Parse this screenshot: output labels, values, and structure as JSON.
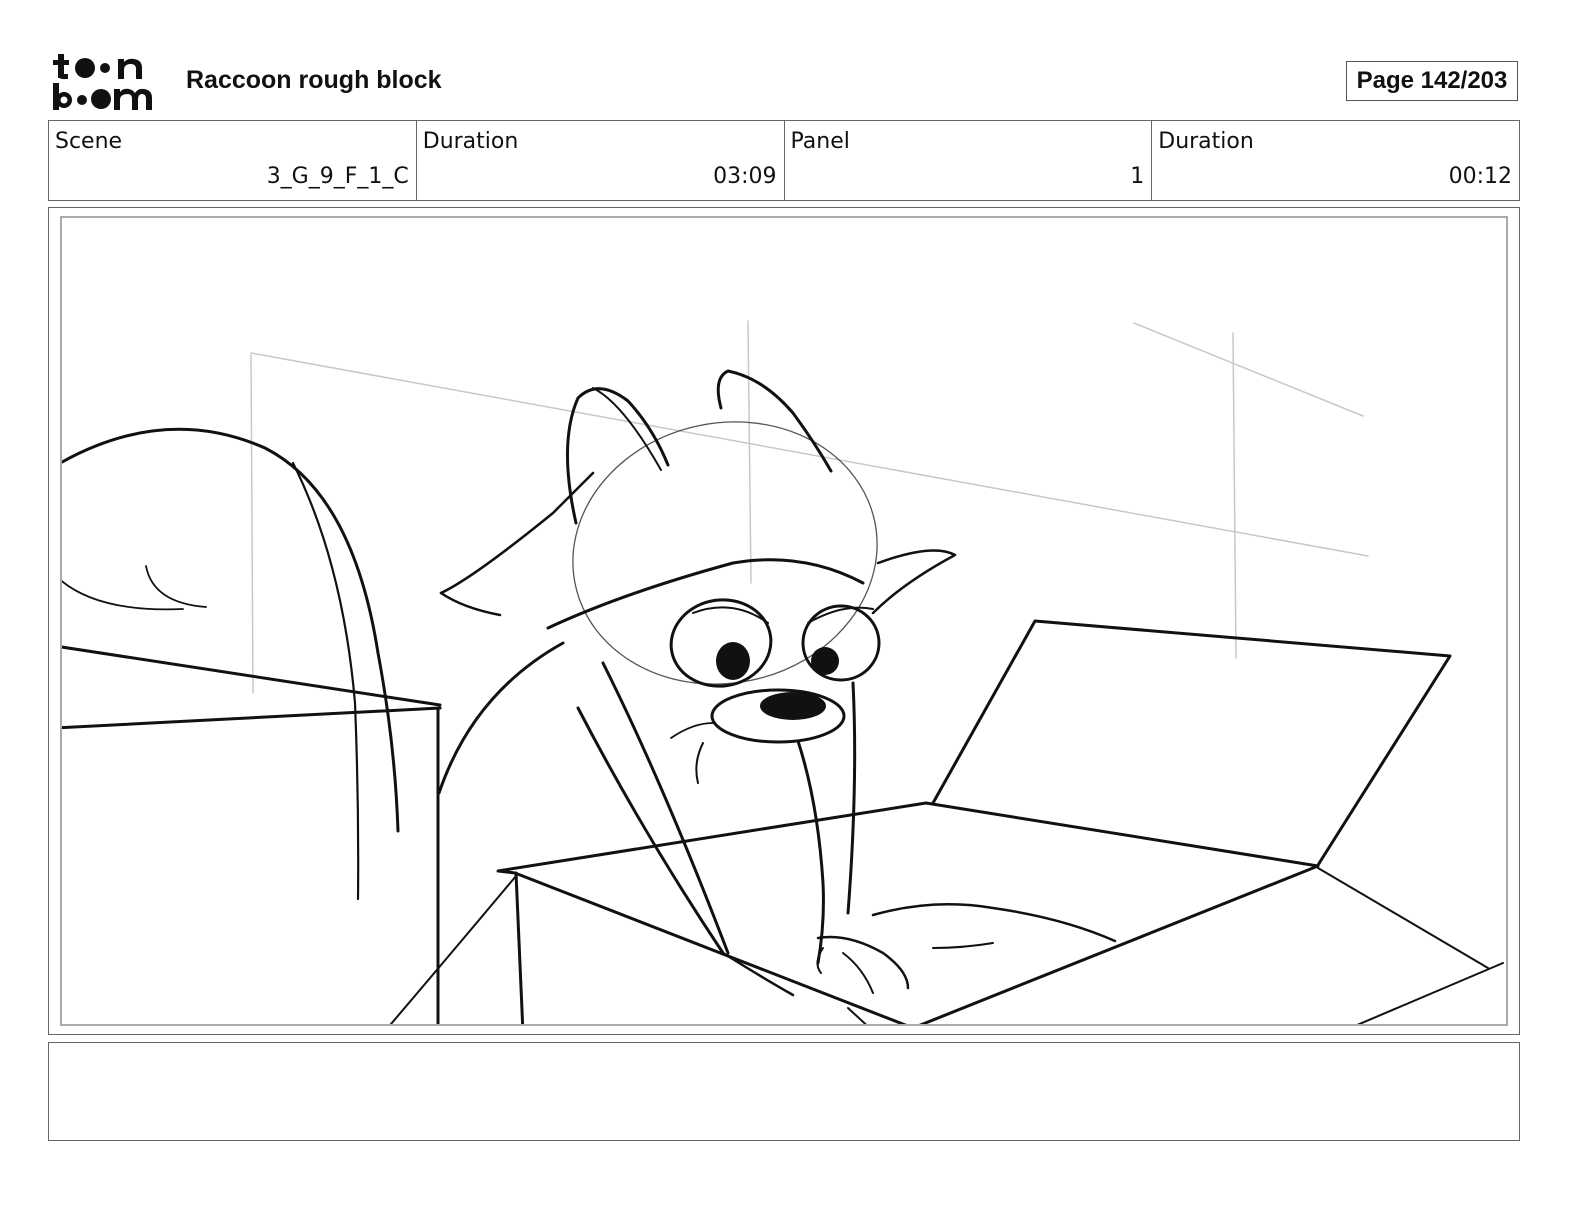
{
  "header": {
    "logo_text": "toon boom",
    "title": "Raccoon rough block",
    "page": "Page 142/203"
  },
  "info": {
    "scene_label": "Scene",
    "scene_value": "3_G_9_F_1_C",
    "scene_duration_label": "Duration",
    "scene_duration_value": "03:09",
    "panel_label": "Panel",
    "panel_value": "1",
    "panel_duration_label": "Duration",
    "panel_duration_value": "00:12"
  },
  "panel_image": {
    "description_icon": "raccoon-sketch-drawing"
  },
  "notes": {
    "text": ""
  }
}
